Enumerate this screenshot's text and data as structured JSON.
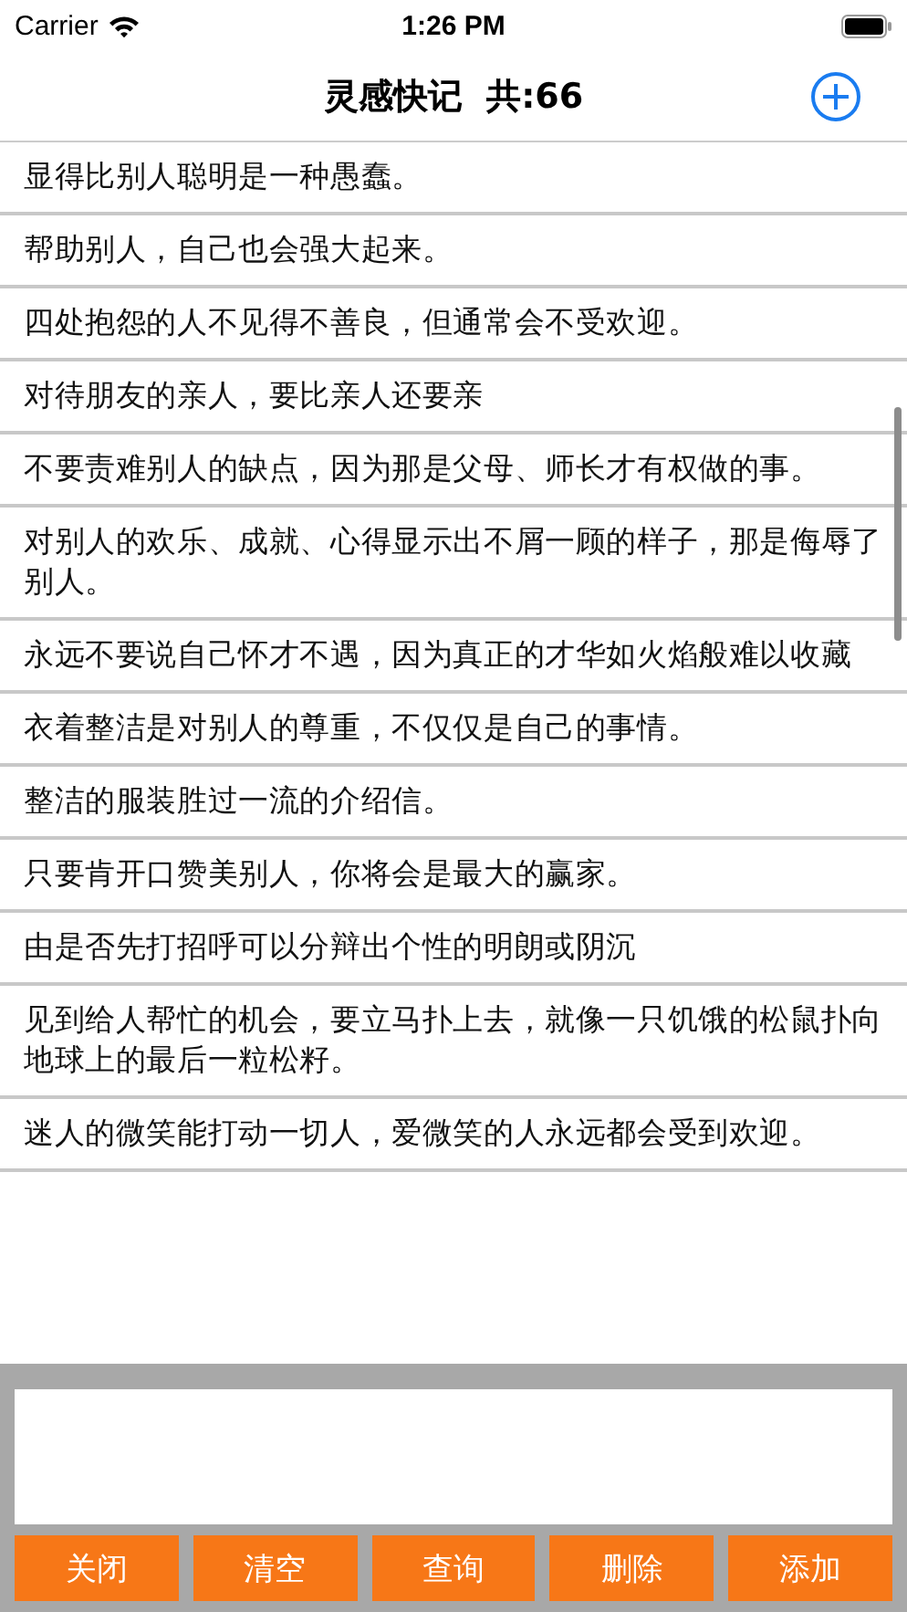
{
  "status_bar": {
    "carrier": "Carrier",
    "time": "1:26 PM"
  },
  "nav": {
    "title": "灵感快记  共:66"
  },
  "notes": [
    "显得比别人聪明是一种愚蠢。",
    "帮助别人，自己也会强大起来。",
    "四处抱怨的人不见得不善良，但通常会不受欢迎。",
    "对待朋友的亲人，要比亲人还要亲",
    "不要责难别人的缺点，因为那是父母、师长才有权做的事。",
    "对别人的欢乐、成就、心得显示出不屑一顾的样子，那是侮辱了别人。",
    "永远不要说自己怀才不遇，因为真正的才华如火焰般难以收藏",
    "衣着整洁是对别人的尊重，不仅仅是自己的事情。",
    "整洁的服装胜过一流的介绍信。",
    "只要肯开口赞美别人，你将会是最大的赢家。",
    "由是否先打招呼可以分辩出个性的明朗或阴沉",
    "见到给人帮忙的机会，要立马扑上去，就像一只饥饿的松鼠扑向地球上的最后一粒松籽。",
    "迷人的微笑能打动一切人，爱微笑的人永远都会受到欢迎。"
  ],
  "buttons": [
    "关闭",
    "清空",
    "查询",
    "删除",
    "添加"
  ]
}
